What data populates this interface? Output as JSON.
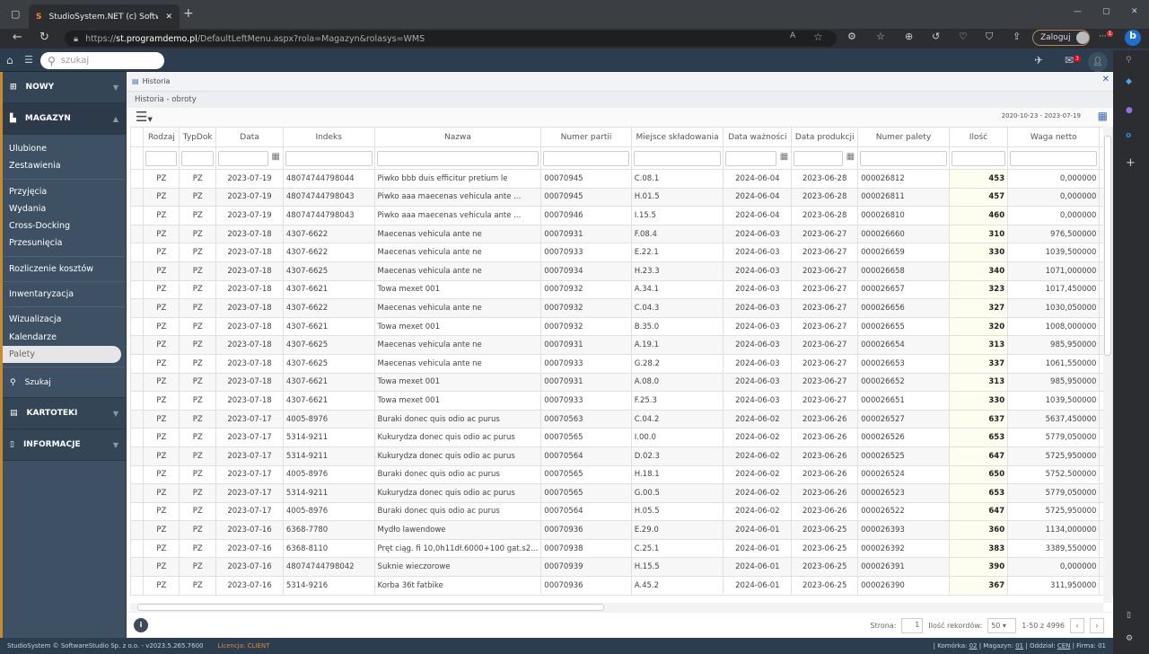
{
  "browser": {
    "tab_title": "StudioSystem.NET (c) SoftwareSt",
    "url_prefix": "https://",
    "url_host": "st.programdemo.pl",
    "url_path": "/DefaultLeftMenu.aspx?rola=Magazyn&rolasys=WMS",
    "login_label": "Zaloguj",
    "ext_badge": "1"
  },
  "header": {
    "search_placeholder": "szukaj",
    "mail_count": "3"
  },
  "sidebar": {
    "nowy": "NOWY",
    "magazyn": "MAGAZYN",
    "groups": [
      [
        "Ulubione",
        "Zestawienia"
      ],
      [
        "Przyjęcia",
        "Wydania",
        "Cross-Docking",
        "Przesunięcia"
      ],
      [
        "Rozliczenie kosztów"
      ],
      [
        "Inwentaryzacja"
      ],
      [
        "Wizualizacja",
        "Kalendarze",
        "Palety"
      ]
    ],
    "active": "Palety",
    "szukaj": "Szukaj",
    "kartoteki": "KARTOTEKI",
    "informacje": "INFORMACJE"
  },
  "main": {
    "window_title": "Historia",
    "breadcrumb": "Historia - obroty",
    "date_range": "2020-10-23 - 2023-07-19",
    "columns": [
      "Rodzaj",
      "TypDok",
      "Data",
      "Indeks",
      "Nazwa",
      "Numer partii",
      "Miejsce składowania",
      "Data ważności",
      "Data produkcji",
      "Numer palety",
      "Ilość",
      "Waga netto"
    ],
    "rows": [
      [
        "PZ",
        "PZ",
        "2023-07-19",
        "48074744798044",
        "Piwko bbb duis efficitur pretium le",
        "00070945",
        "C.08.1",
        "2024-06-04",
        "2023-06-28",
        "000026812",
        "453",
        "0,000000"
      ],
      [
        "PZ",
        "PZ",
        "2023-07-19",
        "48074744798043",
        "Piwko aaa maecenas vehicula ante ...",
        "00070945",
        "H.01.5",
        "2024-06-04",
        "2023-06-28",
        "000026811",
        "457",
        "0,000000"
      ],
      [
        "PZ",
        "PZ",
        "2023-07-19",
        "48074744798043",
        "Piwko aaa maecenas vehicula ante ...",
        "00070946",
        "I.15.5",
        "2024-06-04",
        "2023-06-28",
        "000026810",
        "460",
        "0,000000"
      ],
      [
        "PZ",
        "PZ",
        "2023-07-18",
        "4307-6622",
        "Maecenas vehicula ante ne",
        "00070931",
        "F.08.4",
        "2024-06-03",
        "2023-06-27",
        "000026660",
        "310",
        "976,500000"
      ],
      [
        "PZ",
        "PZ",
        "2023-07-18",
        "4307-6622",
        "Maecenas vehicula ante ne",
        "00070933",
        "E.22.1",
        "2024-06-03",
        "2023-06-27",
        "000026659",
        "330",
        "1039,500000"
      ],
      [
        "PZ",
        "PZ",
        "2023-07-18",
        "4307-6625",
        "Maecenas vehicula ante ne",
        "00070934",
        "H.23.3",
        "2024-06-03",
        "2023-06-27",
        "000026658",
        "340",
        "1071,000000"
      ],
      [
        "PZ",
        "PZ",
        "2023-07-18",
        "4307-6621",
        "Towa mexet 001",
        "00070932",
        "A.34.1",
        "2024-06-03",
        "2023-06-27",
        "000026657",
        "323",
        "1017,450000"
      ],
      [
        "PZ",
        "PZ",
        "2023-07-18",
        "4307-6622",
        "Maecenas vehicula ante ne",
        "00070932",
        "C.04.3",
        "2024-06-03",
        "2023-06-27",
        "000026656",
        "327",
        "1030,050000"
      ],
      [
        "PZ",
        "PZ",
        "2023-07-18",
        "4307-6621",
        "Towa mexet 001",
        "00070932",
        "B.35.0",
        "2024-06-03",
        "2023-06-27",
        "000026655",
        "320",
        "1008,000000"
      ],
      [
        "PZ",
        "PZ",
        "2023-07-18",
        "4307-6625",
        "Maecenas vehicula ante ne",
        "00070931",
        "A.19.1",
        "2024-06-03",
        "2023-06-27",
        "000026654",
        "313",
        "985,950000"
      ],
      [
        "PZ",
        "PZ",
        "2023-07-18",
        "4307-6625",
        "Maecenas vehicula ante ne",
        "00070933",
        "G.28.2",
        "2024-06-03",
        "2023-06-27",
        "000026653",
        "337",
        "1061,550000"
      ],
      [
        "PZ",
        "PZ",
        "2023-07-18",
        "4307-6621",
        "Towa mexet 001",
        "00070931",
        "A.08.0",
        "2024-06-03",
        "2023-06-27",
        "000026652",
        "313",
        "985,950000"
      ],
      [
        "PZ",
        "PZ",
        "2023-07-18",
        "4307-6621",
        "Towa mexet 001",
        "00070933",
        "F.25.3",
        "2024-06-03",
        "2023-06-27",
        "000026651",
        "330",
        "1039,500000"
      ],
      [
        "PZ",
        "PZ",
        "2023-07-17",
        "4005-8976",
        "Buraki donec quis odio ac purus",
        "00070563",
        "C.04.2",
        "2024-06-02",
        "2023-06-26",
        "000026527",
        "637",
        "5637,450000"
      ],
      [
        "PZ",
        "PZ",
        "2023-07-17",
        "5314-9211",
        "Kukurydza donec quis odio ac purus",
        "00070565",
        "I.00.0",
        "2024-06-02",
        "2023-06-26",
        "000026526",
        "653",
        "5779,050000"
      ],
      [
        "PZ",
        "PZ",
        "2023-07-17",
        "5314-9211",
        "Kukurydza donec quis odio ac purus",
        "00070564",
        "D.02.3",
        "2024-06-02",
        "2023-06-26",
        "000026525",
        "647",
        "5725,950000"
      ],
      [
        "PZ",
        "PZ",
        "2023-07-17",
        "4005-8976",
        "Buraki donec quis odio ac purus",
        "00070565",
        "H.18.1",
        "2024-06-02",
        "2023-06-26",
        "000026524",
        "650",
        "5752,500000"
      ],
      [
        "PZ",
        "PZ",
        "2023-07-17",
        "5314-9211",
        "Kukurydza donec quis odio ac purus",
        "00070565",
        "G.00.5",
        "2024-06-02",
        "2023-06-26",
        "000026523",
        "653",
        "5779,050000"
      ],
      [
        "PZ",
        "PZ",
        "2023-07-17",
        "4005-8976",
        "Buraki donec quis odio ac purus",
        "00070564",
        "H.05.5",
        "2024-06-02",
        "2023-06-26",
        "000026522",
        "647",
        "5725,950000"
      ],
      [
        "PZ",
        "PZ",
        "2023-07-16",
        "6368-7780",
        "Mydło lawendowe",
        "00070936",
        "E.29.0",
        "2024-06-01",
        "2023-06-25",
        "000026393",
        "360",
        "1134,000000"
      ],
      [
        "PZ",
        "PZ",
        "2023-07-16",
        "6368-8110",
        "Pręt ciąg. fi 10,0h11dł.6000+100 gat.s2...",
        "00070938",
        "C.25.1",
        "2024-06-01",
        "2023-06-25",
        "000026392",
        "383",
        "3389,550000"
      ],
      [
        "PZ",
        "PZ",
        "2023-07-16",
        "48074744798042",
        "Suknie wieczorowe",
        "00070939",
        "H.15.5",
        "2024-06-01",
        "2023-06-25",
        "000026391",
        "390",
        "0,000000"
      ],
      [
        "PZ",
        "PZ",
        "2023-07-16",
        "5314-9216",
        "Korba 36t fatbike",
        "00070936",
        "A.45.2",
        "2024-06-01",
        "2023-06-25",
        "000026390",
        "367",
        "311,950000"
      ]
    ]
  },
  "pager": {
    "page_label": "Strona:",
    "page": "1",
    "records_label": "Ilość rekordów:",
    "page_size": "50",
    "range": "1-50 z 4996"
  },
  "footer": {
    "copyright": "StudioSystem © SoftwareStudio Sp. z o.o. - v2023.5.265.7600",
    "license": "Licencja: CLIENT",
    "status_prefix": "| Komórka: ",
    "komorka": "02",
    "magazyn_label": " | Magazyn: ",
    "magazyn": "01",
    "oddzial_label": " | Oddział: ",
    "oddzial": "CEN",
    "firma": " | Firma: 01"
  },
  "colors": {
    "accent": "#c98a2e",
    "header_bg": "#2c3d4f",
    "sidebar_bg": "#3e5063",
    "qty_bg": "#fdfdf0"
  }
}
